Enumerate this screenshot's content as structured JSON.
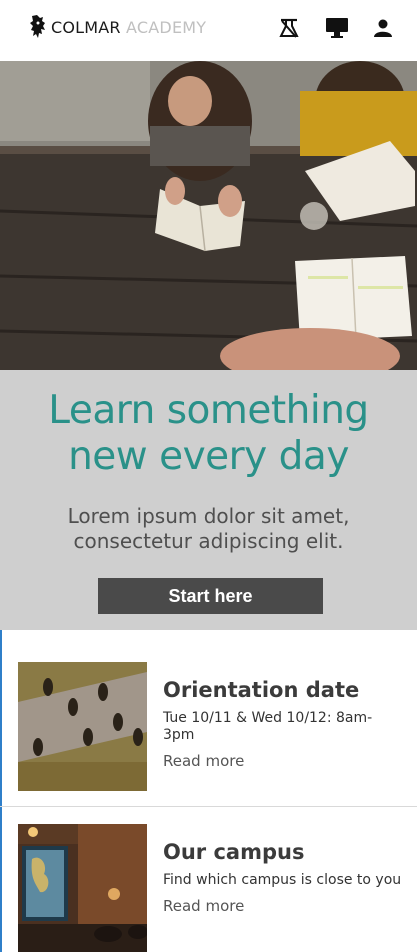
{
  "header": {
    "brand_primary": "COLMAR",
    "brand_secondary": "ACADEMY",
    "nav_icons": [
      "lab-flask-icon",
      "monitor-icon",
      "user-icon"
    ]
  },
  "banner": {
    "headline": "Learn something new every day",
    "subline": "Lorem ipsum dolor sit amet, consectetur adipiscing elit.",
    "cta_label": "Start here",
    "accent_color": "#2a9189",
    "background_color": "#cfcfcf"
  },
  "cards": [
    {
      "title": "Orientation date",
      "description": "Tue 10/11 & Wed 10/12: 8am-3pm",
      "link_label": "Read more"
    },
    {
      "title": "Our campus",
      "description": "Find which campus is close to you",
      "link_label": "Read more"
    }
  ]
}
